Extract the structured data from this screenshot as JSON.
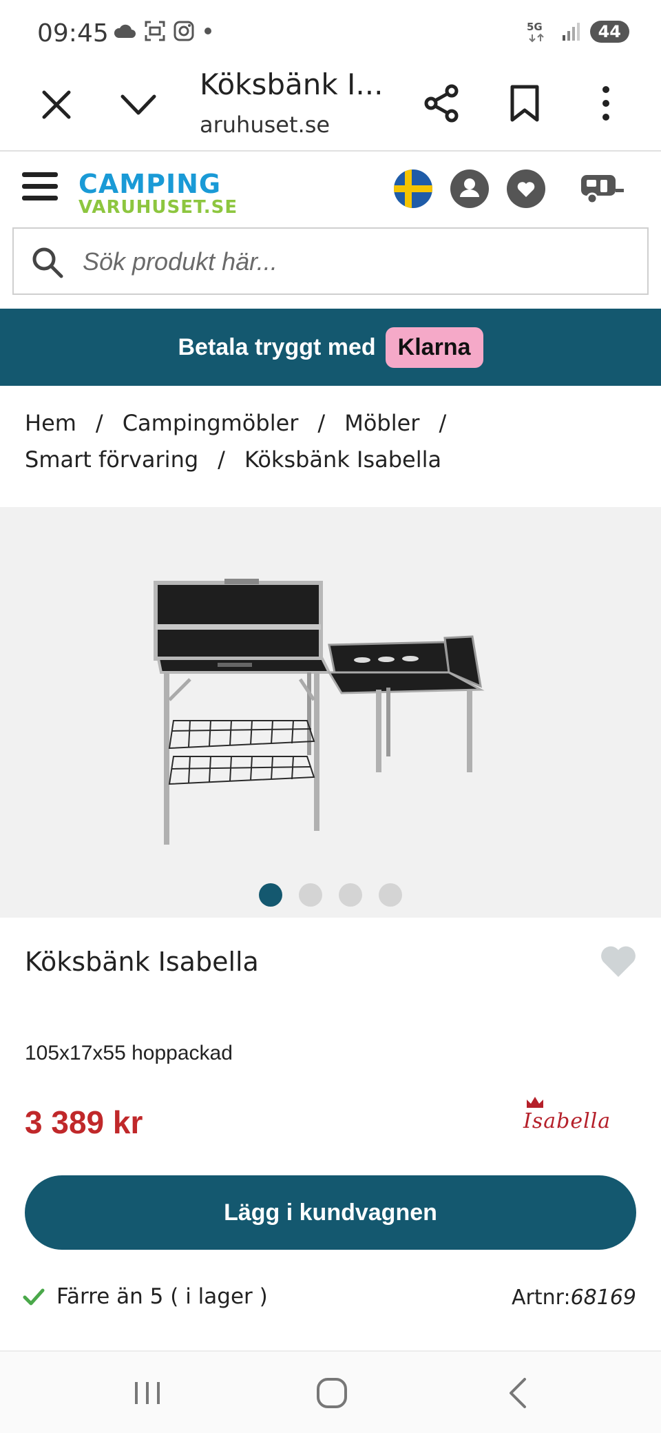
{
  "status_bar": {
    "time": "09:45",
    "network": "5G",
    "battery": "44",
    "left_icons": [
      "cloud-icon",
      "screenshot-icon",
      "instagram-icon",
      "dot-icon"
    ]
  },
  "browser": {
    "title": "Köksbänk I...",
    "domain": "aruhuset.se"
  },
  "site": {
    "logo_top": "CAMPING",
    "logo_bottom": "VARUHUSET.SE",
    "brand_blue": "#1a9ad6",
    "brand_green": "#8dc63f",
    "header_icons": [
      "menu-icon",
      "sweden-flag-icon",
      "user-icon",
      "heart-icon",
      "caravan-icon"
    ]
  },
  "search": {
    "placeholder": "Sök produkt här..."
  },
  "banner": {
    "text": "Betala tryggt med",
    "badge": "Klarna",
    "background": "#14586f",
    "badge_color": "#f5a9c8"
  },
  "breadcrumb": {
    "items": [
      "Hem",
      "Campingmöbler",
      "Möbler",
      "Smart förvaring",
      "Köksbänk Isabella"
    ],
    "separator": "/"
  },
  "gallery": {
    "image_count": 4,
    "active_index": 0
  },
  "product": {
    "title": "Köksbänk Isabella",
    "description": "105x17x55 hoppackad",
    "price": "3 389 kr",
    "price_color": "#c0282a",
    "brand": "Isabella",
    "cart_button": "Lägg i kundvagnen",
    "stock": "Färre än 5 ( i lager )",
    "artnr_label": "Artnr:",
    "artnr_value": "68169"
  },
  "nav_bar": {
    "buttons": [
      "recent-apps-icon",
      "home-icon",
      "back-icon"
    ]
  }
}
